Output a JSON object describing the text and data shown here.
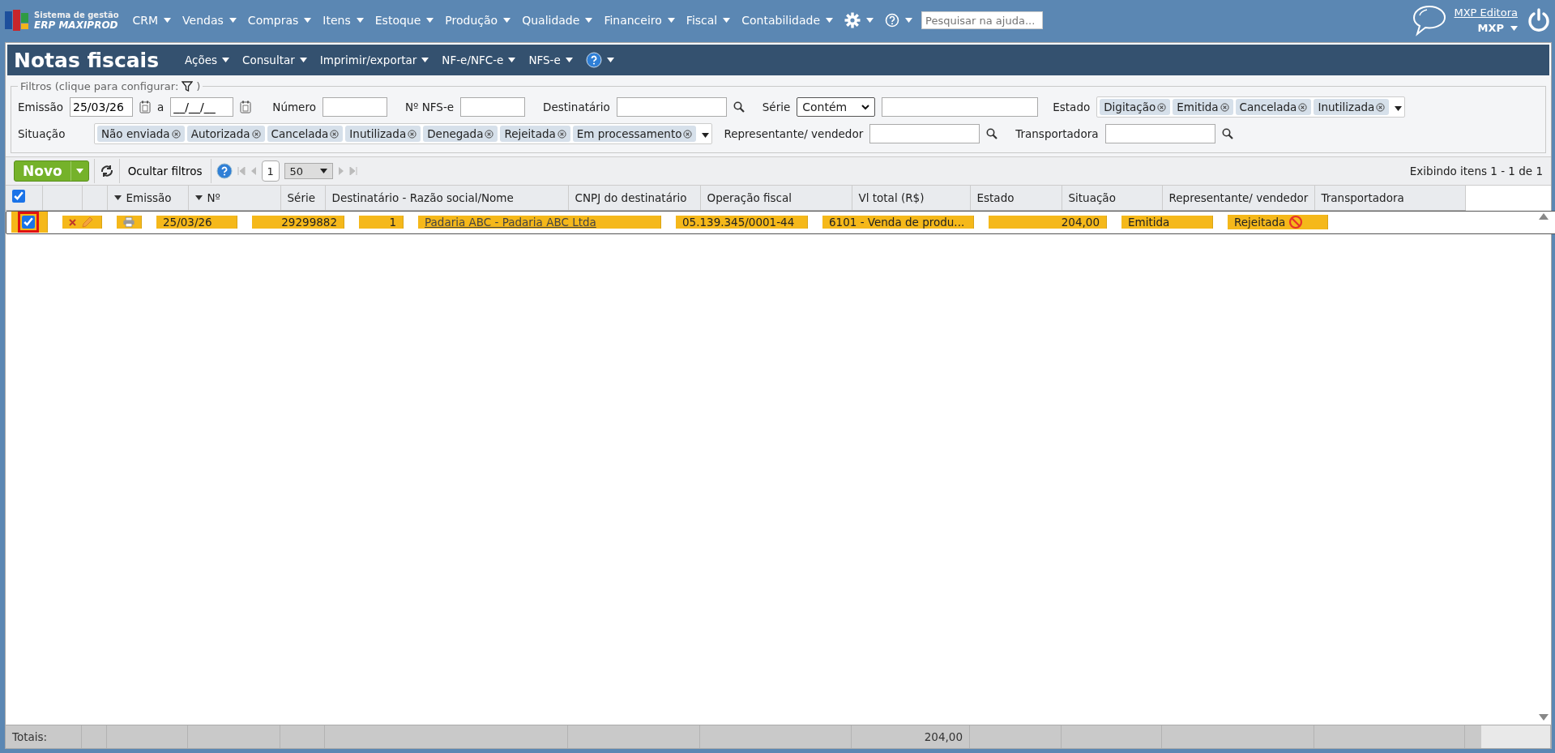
{
  "topbar": {
    "logo_line1": "Sistema de gestão",
    "logo_line2": "ERP MAXIPROD",
    "menu": [
      "CRM",
      "Vendas",
      "Compras",
      "Itens",
      "Estoque",
      "Produção",
      "Qualidade",
      "Financeiro",
      "Fiscal",
      "Contabilidade"
    ],
    "help_search": {
      "placeholder": "Pesquisar na ajuda..."
    },
    "user": {
      "name": "MXP Editora",
      "company": "MXP"
    }
  },
  "page": {
    "title": "Notas fiscais",
    "menu": [
      "Ações",
      "Consultar",
      "Imprimir/exportar",
      "NF-e/NFC-e",
      "NFS-e"
    ]
  },
  "filters": {
    "legend": "Filtros (clique para configurar:",
    "legend_end": ")",
    "emissao": {
      "label": "Emissão",
      "from": "25/03/26",
      "separator": "a",
      "to": "__/__/__"
    },
    "numero": {
      "label": "Número"
    },
    "nfse": {
      "label": "Nº NFS-e"
    },
    "destinatario": {
      "label": "Destinatário"
    },
    "serie": {
      "label": "Série",
      "operator": "Contém"
    },
    "estado": {
      "label": "Estado",
      "tags": [
        "Digitação",
        "Emitida",
        "Cancelada",
        "Inutilizada"
      ]
    },
    "situacao": {
      "label": "Situação",
      "tags": [
        "Não enviada",
        "Autorizada",
        "Cancelada",
        "Inutilizada",
        "Denegada",
        "Rejeitada",
        "Em processamento"
      ]
    },
    "representante": {
      "label": "Representante/ vendedor"
    },
    "transportadora": {
      "label": "Transportadora"
    }
  },
  "toolbar": {
    "new_button": "Novo",
    "hide_filters": "Ocultar filtros",
    "page": "1",
    "page_size": "50",
    "status": "Exibindo itens 1 - 1 de 1"
  },
  "table": {
    "all_checked": true,
    "columns": [
      {
        "label": "Emissão",
        "sorted": true
      },
      {
        "label": "Nº",
        "sorted": true
      },
      {
        "label": "Série",
        "sorted": false
      },
      {
        "label": "Destinatário - Razão social/Nome",
        "sorted": false
      },
      {
        "label": "CNPJ do destinatário",
        "sorted": false
      },
      {
        "label": "Operação fiscal",
        "sorted": false
      },
      {
        "label": "Vl total (R$)",
        "sorted": false
      },
      {
        "label": "Estado",
        "sorted": false
      },
      {
        "label": "Situação",
        "sorted": false
      },
      {
        "label": "Representante/ vendedor",
        "sorted": false
      },
      {
        "label": "Transportadora",
        "sorted": false
      }
    ],
    "rows": [
      {
        "checked": true,
        "selected": true,
        "emissao": "25/03/26",
        "numero": "29299882",
        "serie": "1",
        "destinatario": "Padaria ABC - Padaria ABC Ltda",
        "cnpj": "05.139.345/0001-44",
        "operacao": "6101 - Venda de produ...",
        "total": "204,00",
        "estado": "Emitida",
        "situacao": "Rejeitada"
      }
    ],
    "totals": {
      "label": "Totais:",
      "total": "204,00"
    }
  }
}
